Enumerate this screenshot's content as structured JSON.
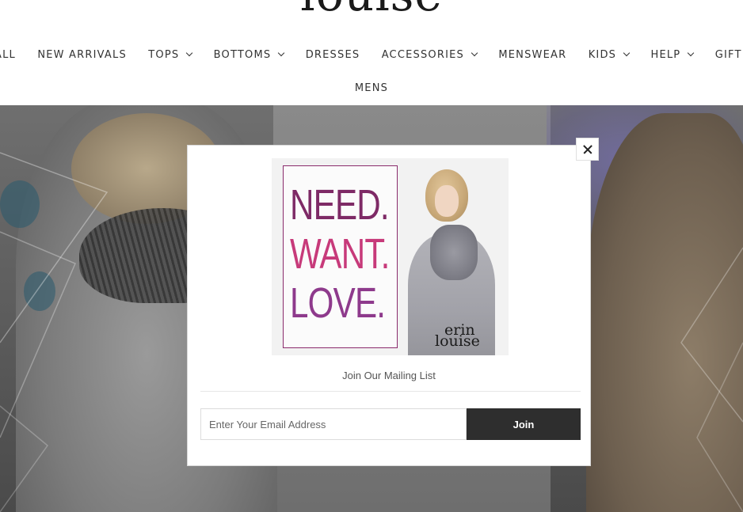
{
  "header": {
    "logo_text": "louise",
    "nav": [
      {
        "label": "ALL",
        "has_dropdown": false
      },
      {
        "label": "NEW ARRIVALS",
        "has_dropdown": false
      },
      {
        "label": "TOPS",
        "has_dropdown": true
      },
      {
        "label": "BOTTOMS",
        "has_dropdown": true
      },
      {
        "label": "DRESSES",
        "has_dropdown": false
      },
      {
        "label": "ACCESSORIES",
        "has_dropdown": true
      },
      {
        "label": "MENSWEAR",
        "has_dropdown": false
      },
      {
        "label": "KIDS",
        "has_dropdown": true
      },
      {
        "label": "HELP",
        "has_dropdown": true
      },
      {
        "label": "GIFT",
        "has_dropdown": false
      }
    ],
    "nav_row2": "MENS"
  },
  "modal": {
    "close_icon": "close-icon",
    "promo": {
      "line1": "NEED.",
      "line2": "WANT.",
      "line3": "LOVE.",
      "brand_line1": "erin",
      "brand_line2": "louise"
    },
    "mailing_title": "Join Our Mailing List",
    "email_placeholder": "Enter Your Email Address",
    "email_value": "",
    "join_label": "Join"
  },
  "colors": {
    "join_bg": "#2e2e2e",
    "slogan_purple": "#7e2a66",
    "slogan_pink": "#c73a7a",
    "slogan_violet": "#8e3a8c"
  }
}
